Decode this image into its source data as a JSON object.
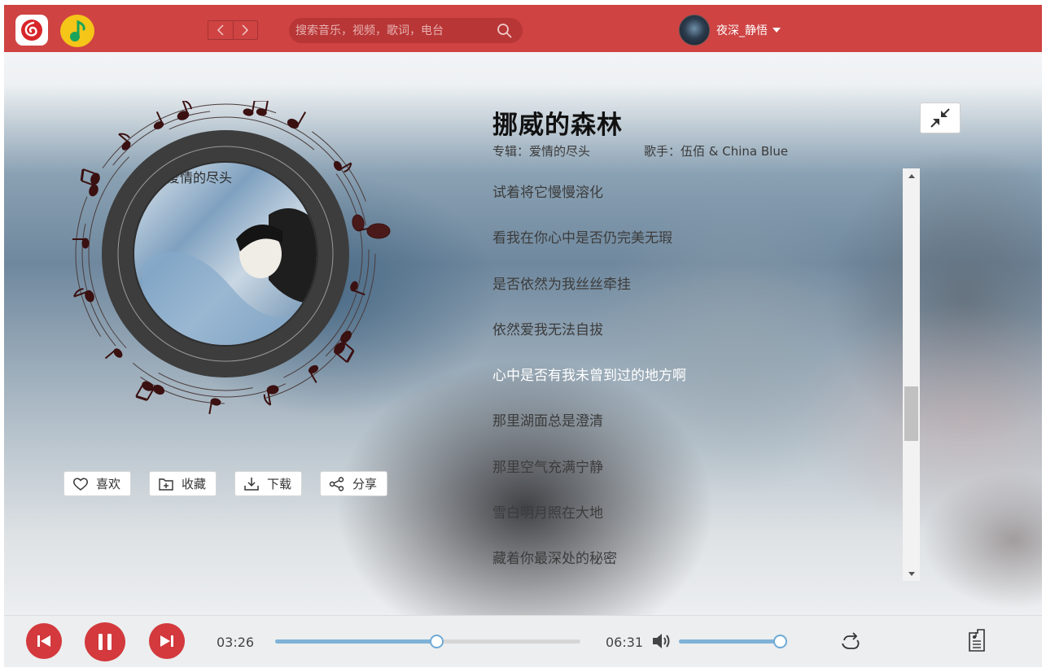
{
  "header": {
    "logo_netease": "netease-music-logo",
    "logo_qq": "qq-music-logo",
    "search_placeholder": "搜索音乐，视频，歌词，电台",
    "username": "夜深_静悟"
  },
  "song": {
    "title": "挪威的森林",
    "album_label": "专辑：爱情的尽头",
    "artist_label": "歌手：伍佰 & China Blue"
  },
  "album_art": {
    "cover_text": "爱情的尽头"
  },
  "actions": {
    "like": "喜欢",
    "collect": "收藏",
    "download": "下载",
    "share": "分享"
  },
  "lyrics": {
    "lines": [
      "试着将它慢慢溶化",
      "看我在你心中是否仍完美无瑕",
      "是否依然为我丝丝牵挂",
      "依然爱我无法自拔",
      "心中是否有我未曾到过的地方啊",
      "那里湖面总是澄清",
      "那里空气充满宁静",
      "雪白明月照在大地",
      "藏着你最深处的秘密"
    ],
    "active_index": 4
  },
  "player": {
    "current_time": "03:26",
    "total_time": "06:31",
    "progress": 0.527,
    "volume": 1.0
  },
  "colors": {
    "brand_red": "#cf4343",
    "control_red": "#d3393d",
    "progress_blue": "#7fb2d8"
  }
}
